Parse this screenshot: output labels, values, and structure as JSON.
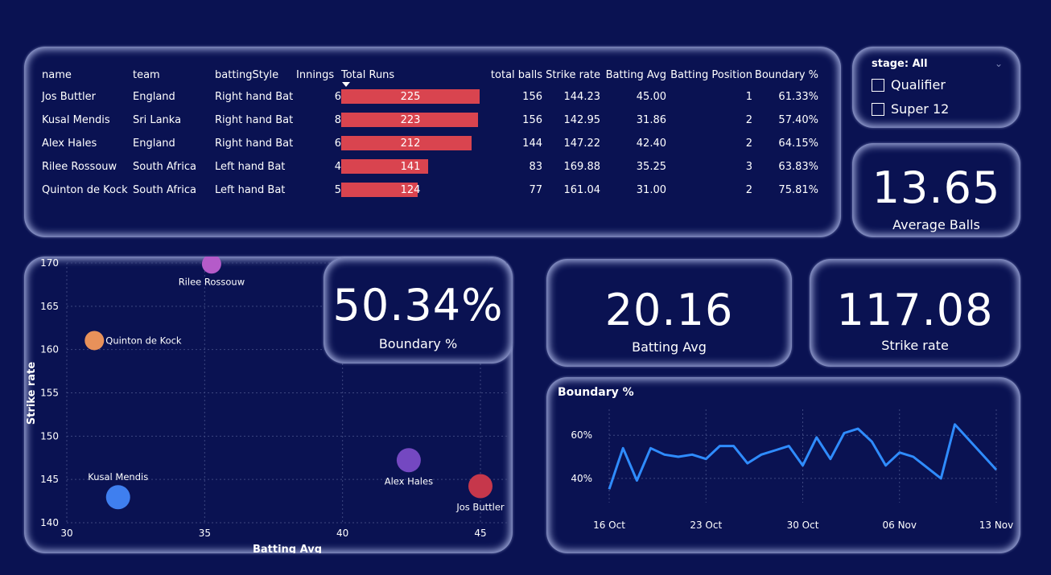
{
  "table": {
    "headers": [
      "name",
      "team",
      "battingStyle",
      "Innings",
      "Total Runs",
      "total balls",
      "Strike rate",
      "Batting Avg",
      "Batting Position",
      "Boundary %"
    ],
    "rows": [
      {
        "name": "Jos Buttler",
        "team": "England",
        "style": "Right hand Bat",
        "innings": "6",
        "runs": 225,
        "runs_label": "225",
        "balls": "156",
        "sr": "144.23",
        "avg": "45.00",
        "pos": "1",
        "bp": "61.33%"
      },
      {
        "name": "Kusal Mendis",
        "team": "Sri Lanka",
        "style": "Right hand Bat",
        "innings": "8",
        "runs": 223,
        "runs_label": "223",
        "balls": "156",
        "sr": "142.95",
        "avg": "31.86",
        "pos": "2",
        "bp": "57.40%"
      },
      {
        "name": "Alex Hales",
        "team": "England",
        "style": "Right hand Bat",
        "innings": "6",
        "runs": 212,
        "runs_label": "212",
        "balls": "144",
        "sr": "147.22",
        "avg": "42.40",
        "pos": "2",
        "bp": "64.15%"
      },
      {
        "name": "Rilee Rossouw",
        "team": "South Africa",
        "style": "Left hand Bat",
        "innings": "4",
        "runs": 141,
        "runs_label": "141",
        "balls": "83",
        "sr": "169.88",
        "avg": "35.25",
        "pos": "3",
        "bp": "63.83%"
      },
      {
        "name": "Quinton de Kock",
        "team": "South Africa",
        "style": "Left hand Bat",
        "innings": "5",
        "runs": 124,
        "runs_label": "124",
        "balls": "77",
        "sr": "161.04",
        "avg": "31.00",
        "pos": "2",
        "bp": "75.81%"
      }
    ]
  },
  "slicer": {
    "title": "stage: All",
    "options": [
      "Qualifier",
      "Super 12"
    ]
  },
  "kpis": {
    "average_balls": {
      "value": "13.65",
      "label": "Average Balls"
    },
    "boundary_pct": {
      "value": "50.34%",
      "label": "Boundary %"
    },
    "batting_avg": {
      "value": "20.16",
      "label": "Batting Avg"
    },
    "strike_rate": {
      "value": "117.08",
      "label": "Strike rate"
    }
  },
  "colors": {
    "background": "#0a1252",
    "bar": "#d9444f",
    "line": "#2f8cff"
  },
  "chart_data": [
    {
      "type": "scatter",
      "xlabel": "Batting Avg",
      "ylabel": "Strike rate",
      "xlim": [
        30,
        46
      ],
      "ylim": [
        140,
        170
      ],
      "xticks": [
        "30",
        "35",
        "40",
        "45"
      ],
      "yticks": [
        "140",
        "145",
        "150",
        "155",
        "160",
        "165",
        "170"
      ],
      "grid": true,
      "points": [
        {
          "label": "Rilee Rossouw",
          "x": 35.25,
          "y": 169.88,
          "color": "#b55bc9"
        },
        {
          "label": "Quinton de Kock",
          "x": 31.0,
          "y": 161.04,
          "color": "#e8915a"
        },
        {
          "label": "Kusal Mendis",
          "x": 31.86,
          "y": 142.95,
          "color": "#3f7fef"
        },
        {
          "label": "Alex Hales",
          "x": 42.4,
          "y": 147.22,
          "color": "#7448c1"
        },
        {
          "label": "Jos Buttler",
          "x": 45.0,
          "y": 144.23,
          "color": "#c6374b"
        }
      ]
    },
    {
      "type": "line",
      "title": "Boundary %",
      "xlabel": "",
      "ylabel": "",
      "xticks": [
        "16 Oct",
        "23 Oct",
        "30 Oct",
        "06 Nov",
        "13 Nov"
      ],
      "yticks": [
        "40%",
        "60%"
      ],
      "ylim": [
        31,
        72
      ],
      "grid": true,
      "x": [
        "2022-10-16",
        "2022-10-17",
        "2022-10-18",
        "2022-10-19",
        "2022-10-20",
        "2022-10-21",
        "2022-10-22",
        "2022-10-23",
        "2022-10-24",
        "2022-10-25",
        "2022-10-26",
        "2022-10-27",
        "2022-10-28",
        "2022-10-29",
        "2022-10-30",
        "2022-10-31",
        "2022-11-01",
        "2022-11-02",
        "2022-11-03",
        "2022-11-04",
        "2022-11-05",
        "2022-11-06",
        "2022-11-07",
        "2022-11-09",
        "2022-11-10",
        "2022-11-13"
      ],
      "series": [
        {
          "values": [
            35,
            54,
            39,
            54,
            51,
            50,
            51,
            49,
            55,
            55,
            47,
            51,
            53,
            55,
            46,
            59,
            49,
            61,
            63,
            57,
            46,
            52,
            50,
            40,
            65,
            44
          ]
        }
      ]
    }
  ]
}
